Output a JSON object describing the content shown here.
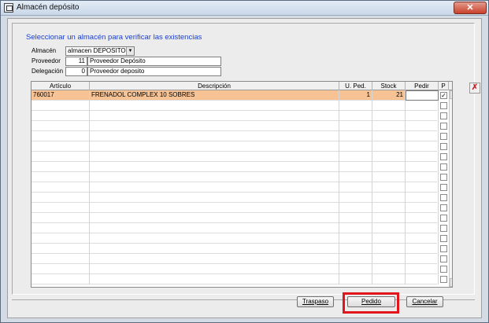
{
  "window": {
    "title": "Almacén depósito",
    "close_glyph": "✕"
  },
  "form": {
    "heading": "Seleccionar un almacén para verificar las existencias",
    "almacen_label": "Almacén",
    "almacen_value": "almacen DEPOSITO",
    "proveedor_label": "Proveedor",
    "proveedor_code": "11",
    "proveedor_name": "Proveedor Depósito",
    "delegacion_label": "Delegación",
    "delegacion_code": "0",
    "delegacion_name": "Proveedor deposito"
  },
  "grid": {
    "columns": [
      "Artículo",
      "Descripción",
      "U. Ped.",
      "Stock",
      "Pedir",
      "P"
    ],
    "rows": [
      {
        "articulo": "760017",
        "descripcion": "FRENADOL COMPLEX 10 SOBRES",
        "u_ped": "1",
        "stock": "21",
        "pedir": "",
        "checked": true
      }
    ],
    "empty_rows": 18,
    "selected_color": "#f7c395"
  },
  "icons": {
    "side_tool": "excel-export-icon",
    "check": "✓",
    "up": "▲",
    "down": "▼",
    "dropdown": "▼"
  },
  "buttons": {
    "traspaso": "Traspaso",
    "pedido": "Pedido",
    "cancelar": "Cancelar"
  },
  "colors": {
    "heading": "#1b3fd0",
    "highlight": "#e0161c"
  }
}
